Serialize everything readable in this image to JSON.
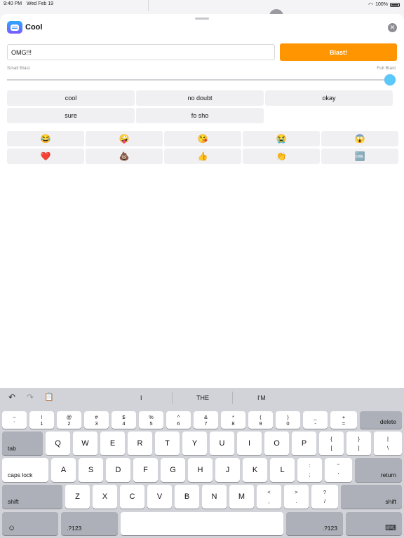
{
  "status": {
    "time": "9:40 PM",
    "date": "Wed Feb 19",
    "battery": "100%"
  },
  "app": {
    "title": "Cool",
    "close": "✕"
  },
  "composer": {
    "value": "OMG!!!",
    "blast_label": "Blast!"
  },
  "slider": {
    "min_label": "Small Blast",
    "max_label": "Full Blast",
    "value": 1.0
  },
  "phrases": [
    "cool",
    "no doubt",
    "okay",
    "sure",
    "fo sho"
  ],
  "emojis": [
    "😂",
    "🤪",
    "😘",
    "😭",
    "😱",
    "❤️",
    "💩",
    "👍",
    "👏",
    "🆒"
  ],
  "keyboard": {
    "toolbar": {
      "undo": "↶",
      "redo": "↷",
      "paste": "📋"
    },
    "suggestions": [
      "I",
      "THE",
      "I'M"
    ],
    "row1": [
      {
        "up": "~",
        "dn": "`"
      },
      {
        "up": "!",
        "dn": "1"
      },
      {
        "up": "@",
        "dn": "2"
      },
      {
        "up": "#",
        "dn": "3"
      },
      {
        "up": "$",
        "dn": "4"
      },
      {
        "up": "%",
        "dn": "5"
      },
      {
        "up": "^",
        "dn": "6"
      },
      {
        "up": "&",
        "dn": "7"
      },
      {
        "up": "*",
        "dn": "8"
      },
      {
        "up": "(",
        "dn": "9"
      },
      {
        "up": ")",
        "dn": "0"
      },
      {
        "up": "_",
        "dn": "-"
      },
      {
        "up": "+",
        "dn": "="
      }
    ],
    "delete": "delete",
    "tab": "tab",
    "row2": [
      "Q",
      "W",
      "E",
      "R",
      "T",
      "Y",
      "U",
      "I",
      "O",
      "P"
    ],
    "row2_sym": [
      {
        "up": "{",
        "dn": "["
      },
      {
        "up": "}",
        "dn": "]"
      },
      {
        "up": "|",
        "dn": "\\"
      }
    ],
    "caps": "caps lock",
    "row3": [
      "A",
      "S",
      "D",
      "F",
      "G",
      "H",
      "J",
      "K",
      "L"
    ],
    "row3_sym": [
      {
        "up": ":",
        "dn": ";"
      },
      {
        "up": "\"",
        "dn": "'"
      }
    ],
    "return": "return",
    "shift": "shift",
    "row4": [
      "Z",
      "X",
      "C",
      "V",
      "B",
      "N",
      "M"
    ],
    "row4_sym": [
      {
        "up": "<",
        "dn": ","
      },
      {
        "up": ">",
        "dn": "."
      },
      {
        "up": "?",
        "dn": "/"
      }
    ],
    "emoji_key": "☺",
    "numbers": ".?123",
    "hide_kb": "⌨"
  }
}
